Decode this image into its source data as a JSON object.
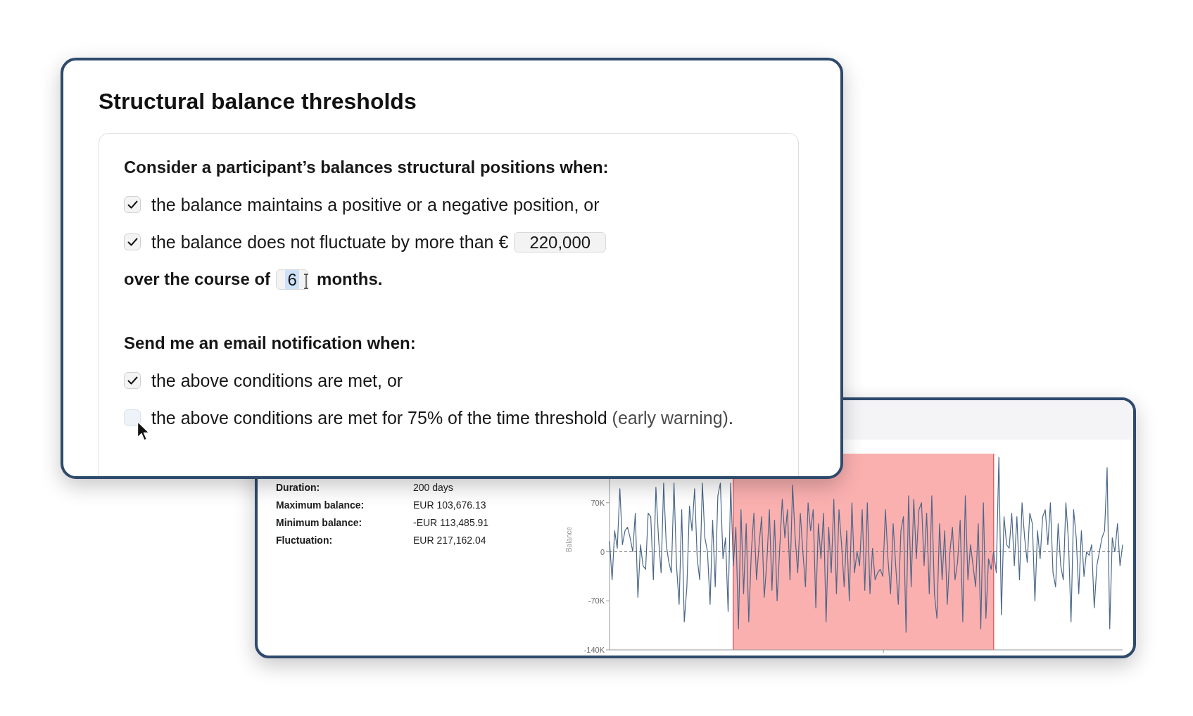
{
  "threshold_panel": {
    "title": "Structural balance thresholds",
    "sections": [
      {
        "heading": "Consider a participant’s balances structural positions when:",
        "options": [
          {
            "label": "the balance maintains a positive or a negative position, or",
            "checked": true
          },
          {
            "label": "the balance does not fluctuate by more than €",
            "checked": true,
            "amount_field": {
              "value": "220,000",
              "text_selected": false
            }
          }
        ],
        "duration": {
          "prefix": "over the course of",
          "field": {
            "value": "6",
            "text_selected": true
          },
          "suffix": "months."
        }
      },
      {
        "heading": "Send me an email notification when:",
        "options": [
          {
            "label": "the above conditions are met, or",
            "checked": true
          },
          {
            "label": "the above conditions are met for 75% of the time threshold",
            "note": "(early warning)",
            "suffix": ".",
            "checked": false
          }
        ]
      }
    ]
  },
  "period_panel": {
    "stats": [
      {
        "label": "Duration:",
        "value": "200 days"
      },
      {
        "label": "Maximum balance:",
        "value": "EUR 103,676.13"
      },
      {
        "label": "Minimum balance:",
        "value": "-EUR 113,485.91"
      },
      {
        "label": "Fluctuation:",
        "value": "EUR 217,162.04"
      }
    ],
    "chart_data": {
      "type": "line",
      "ylabel": "Balance",
      "ylim": [
        -140000,
        140000
      ],
      "yticks": [
        {
          "value": 70000,
          "label": "70K"
        },
        {
          "value": 0,
          "label": "0"
        },
        {
          "value": -70000,
          "label": "-70K"
        },
        {
          "value": -140000,
          "label": "-140K"
        }
      ],
      "series": [
        {
          "color": "#4a6788",
          "values": [
            15000,
            -40000,
            30000,
            5000,
            90000,
            10000,
            30000,
            35000,
            20000,
            0,
            55000,
            -65000,
            10000,
            -20000,
            -25000,
            55000,
            50000,
            -40000,
            92000,
            20000,
            -30000,
            98000,
            10000,
            -15000,
            -30000,
            98000,
            -20000,
            -75000,
            60000,
            -100000,
            -50000,
            65000,
            30000,
            90000,
            -10000,
            -40000,
            98000,
            20000,
            0,
            -75000,
            45000,
            -50000,
            80000,
            98000,
            -10000,
            20000,
            -85000,
            98000,
            -20000,
            35000,
            -110000,
            60000,
            -60000,
            40000,
            -100000,
            0,
            55000,
            -40000,
            10000,
            50000,
            -65000,
            -15000,
            60000,
            -55000,
            45000,
            -70000,
            5000,
            75000,
            20000,
            60000,
            -40000,
            95000,
            20000,
            -30000,
            55000,
            0,
            -50000,
            70000,
            30000,
            60000,
            -80000,
            40000,
            -10000,
            55000,
            -100000,
            35000,
            -30000,
            75000,
            -60000,
            60000,
            10000,
            -50000,
            30000,
            -70000,
            70000,
            -30000,
            0,
            -20000,
            60000,
            -55000,
            70000,
            -60000,
            5000,
            -40000,
            -30000,
            -25000,
            -35000,
            60000,
            -10000,
            -60000,
            40000,
            -20000,
            -75000,
            30000,
            50000,
            -115000,
            80000,
            -50000,
            75000,
            -10000,
            60000,
            70000,
            -20000,
            55000,
            -60000,
            80000,
            -60000,
            -95000,
            40000,
            -40000,
            30000,
            -75000,
            0,
            35000,
            -40000,
            -15000,
            45000,
            -100000,
            80000,
            -40000,
            10000,
            -20000,
            -50000,
            40000,
            -110000,
            70000,
            -95000,
            -10000,
            -25000,
            0,
            -30000,
            135000,
            -90000,
            50000,
            10000,
            5000,
            55000,
            -20000,
            50000,
            -40000,
            70000,
            20000,
            -15000,
            55000,
            40000,
            -70000,
            30000,
            -10000,
            50000,
            60000,
            10000,
            70000,
            -30000,
            -50000,
            40000,
            -20000,
            -40000,
            70000,
            15000,
            -100000,
            60000,
            20000,
            -60000,
            30000,
            -35000,
            0,
            -5000,
            10000,
            -80000,
            -20000,
            0,
            20000,
            30000,
            120000,
            -110000,
            20000,
            0,
            40000,
            -20000,
            10000
          ]
        }
      ],
      "ref_lines": [
        {
          "axis": "y",
          "value": 0
        }
      ]
    }
  }
}
